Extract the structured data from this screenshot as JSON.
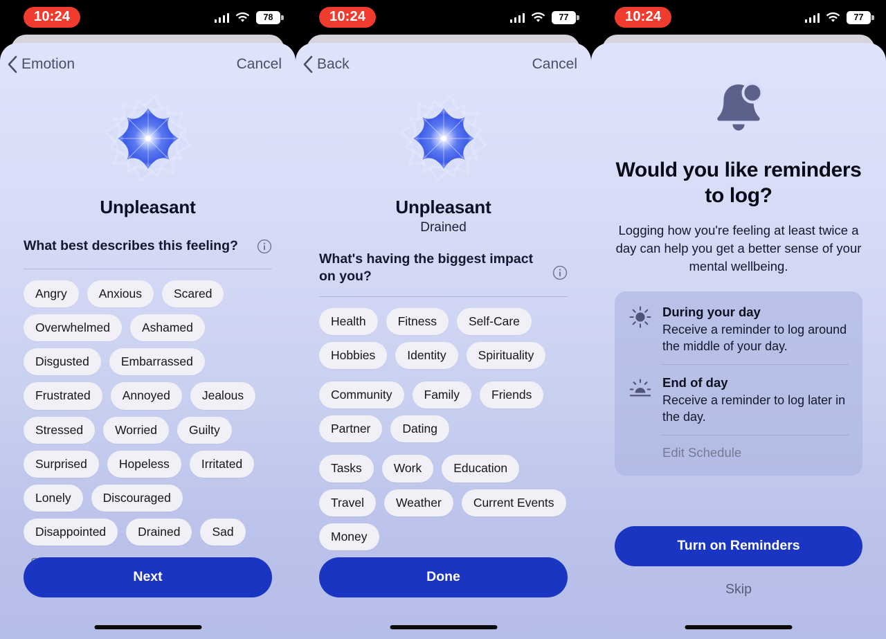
{
  "panels": [
    {
      "id": "emotion-picker",
      "status": {
        "time": "10:24",
        "battery": "78"
      },
      "nav": {
        "back_label": "Emotion",
        "cancel_label": "Cancel"
      },
      "mood": {
        "title": "Unpleasant",
        "subtitle": ""
      },
      "question": "What best describes this feeling?",
      "chip_groups": [
        [
          "Angry",
          "Anxious",
          "Scared",
          "Overwhelmed",
          "Ashamed",
          "Disgusted",
          "Embarrassed",
          "Frustrated",
          "Annoyed",
          "Jealous",
          "Stressed",
          "Worried",
          "Guilty",
          "Surprised",
          "Hopeless",
          "Irritated",
          "Lonely",
          "Discouraged",
          "Disappointed",
          "Drained",
          "Sad"
        ]
      ],
      "show_more_label": "Show More",
      "primary_button": "Next",
      "secondary_button": ""
    },
    {
      "id": "impact-picker",
      "status": {
        "time": "10:24",
        "battery": "77"
      },
      "nav": {
        "back_label": "Back",
        "cancel_label": "Cancel"
      },
      "mood": {
        "title": "Unpleasant",
        "subtitle": "Drained"
      },
      "question": "What's having the biggest impact on you?",
      "chip_groups": [
        [
          "Health",
          "Fitness",
          "Self-Care",
          "Hobbies",
          "Identity",
          "Spirituality"
        ],
        [
          "Community",
          "Family",
          "Friends",
          "Partner",
          "Dating"
        ],
        [
          "Tasks",
          "Work",
          "Education",
          "Travel",
          "Weather",
          "Current Events",
          "Money"
        ]
      ],
      "show_more_label": "",
      "primary_button": "Done",
      "secondary_button": ""
    },
    {
      "id": "reminders-prompt",
      "status": {
        "time": "10:24",
        "battery": "77"
      },
      "hero": {
        "title": "Would you like reminders to log?",
        "body": "Logging how you're feeling at least twice a day can help you get a better sense of your mental wellbeing."
      },
      "reminders": [
        {
          "icon": "sun-icon",
          "title": "During your day",
          "desc": "Receive a reminder to log around the middle of your day."
        },
        {
          "icon": "sunset-icon",
          "title": "End of day",
          "desc": "Receive a reminder to log later in the day."
        }
      ],
      "edit_schedule_label": "Edit Schedule",
      "primary_button": "Turn on Reminders",
      "secondary_button": "Skip"
    }
  ],
  "colors": {
    "accent_blue": "#1a35c2",
    "time_pill_red": "#f03b2f",
    "chip_bg": "#f0f0f6",
    "sheet_top": "#dfe3fb",
    "sheet_bottom": "#b4bce8",
    "icon_slate": "#5c618c"
  }
}
